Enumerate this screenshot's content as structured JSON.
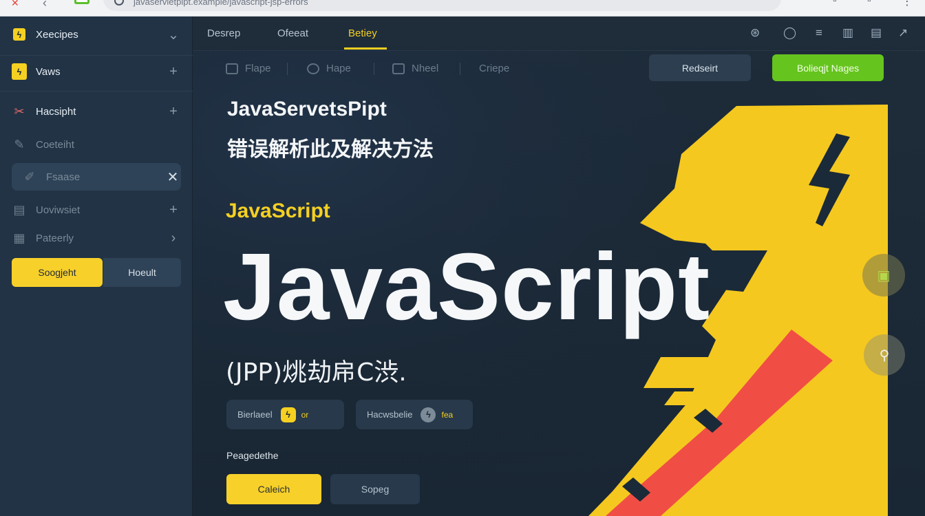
{
  "browser": {
    "url": "javaservletpipt.example/javascript-jsp-errors"
  },
  "sidebar": {
    "header_label": "Xeecipes",
    "items": [
      {
        "label": "Vaws",
        "trail": "+"
      },
      {
        "label": "Hacsipht",
        "trail": "+"
      },
      {
        "label": "Coeteiht",
        "trail": ""
      },
      {
        "label": "Fsaase",
        "trail": "✕"
      },
      {
        "label": "Uoviwsiet",
        "trail": "+"
      },
      {
        "label": "Pateerly",
        "trail": "›"
      }
    ],
    "primary_button": "Soogjeht",
    "secondary_button": "Hoeult"
  },
  "topnav": {
    "tabs": [
      {
        "label": "Desrep"
      },
      {
        "label": "Ofeeat"
      },
      {
        "label": "Betiey"
      }
    ],
    "active_tab": "Betiey"
  },
  "toolbar": {
    "items": [
      "Flape",
      "Hape",
      "Nheel",
      "Criepe"
    ],
    "reset_button": "Redseirt",
    "green_button": "Bolieqjt Nages"
  },
  "hero": {
    "line1": "JavaServetsPipt",
    "line2": "错误解析此及解决方法",
    "kicker": "JavaScript",
    "title": "JavaScript",
    "subtitle": "(JPP)烑劫帍C渋."
  },
  "chips": [
    {
      "label": "Bierlaeel",
      "value": "or",
      "icon": "lightning-badge"
    },
    {
      "label": "Hacwsbelie",
      "value": "fea",
      "icon": "lightning-badge"
    }
  ],
  "section": {
    "label": "Peagedethe",
    "primary_button": "Caleich",
    "secondary_button": "Sopeg"
  },
  "colors": {
    "accent_yellow": "#f5d021",
    "accent_green": "#66c41e",
    "accent_red": "#f04e44",
    "background": "#1b2a38"
  }
}
